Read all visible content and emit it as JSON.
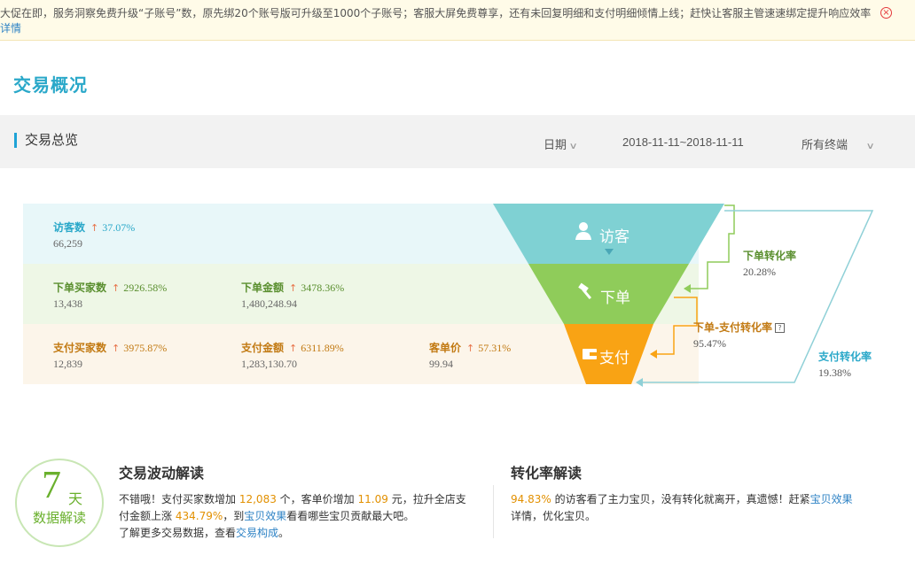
{
  "notice": {
    "line1": "大促在即，服务洞察免费升级“子账号”数，原先绑20个账号版可升级至1000个子账号；客服大屏免费尊享，还有未回复明细和支付明细倾情上线；赶快让客服主管速速绑定提升响应效率",
    "line2": "详情",
    "close_icon": "close-circle-icon"
  },
  "page_title": "交易概况",
  "overview": {
    "title": "交易总览",
    "date_label": "日期",
    "date_range": "2018-11-11~2018-11-11",
    "terminal_label": "所有终端"
  },
  "metrics": {
    "visitors": {
      "label": "访客数",
      "change": "37.07%",
      "value": "66,259"
    },
    "order_buyers": {
      "label": "下单买家数",
      "change": "2926.58%",
      "value": "13,438"
    },
    "order_amount": {
      "label": "下单金额",
      "change": "3478.36%",
      "value": "1,480,248.94"
    },
    "pay_buyers": {
      "label": "支付买家数",
      "change": "3975.87%",
      "value": "12,839"
    },
    "pay_amount": {
      "label": "支付金额",
      "change": "6311.89%",
      "value": "1,283,130.70"
    },
    "unit_price": {
      "label": "客单价",
      "change": "57.31%",
      "value": "99.94"
    }
  },
  "trend_arrow": "↑",
  "funnel": {
    "visit_label": "访客",
    "order_label": "下单",
    "pay_label": "支付",
    "colors": {
      "visit": "#7fd1d3",
      "order": "#8fcc5a",
      "pay": "#f9a314"
    }
  },
  "conversions": {
    "order_rate": {
      "label": "下单转化率",
      "value": "20.28%"
    },
    "order_pay_rate": {
      "label": "下单-支付转化率",
      "value": "95.47%"
    },
    "pay_rate": {
      "label": "支付转化率",
      "value": "19.38%"
    }
  },
  "badge": {
    "number": "7",
    "unit": "天",
    "text": "数据解读"
  },
  "trade_analysis": {
    "title": "交易波动解读",
    "p1": "不错哦！支付买家数增加",
    "v1": "12,083",
    "p2": "个，客单价增加",
    "v2": "11.09",
    "p3": "元，拉升全店支付金额上涨",
    "v3": "434.79%",
    "p4": "，到",
    "link1": "宝贝效果",
    "p5": "看看哪些宝贝贡献最大吧。",
    "p6": "了解更多交易数据，查看",
    "link2": "交易构成",
    "p7": "。"
  },
  "conversion_analysis": {
    "title": "转化率解读",
    "v1": "94.83%",
    "p1": "的访客看了主力宝贝，没有转化就离开，真遗憾！赶紧",
    "link1": "宝贝效果",
    "p2": "详情，优化宝贝。"
  }
}
